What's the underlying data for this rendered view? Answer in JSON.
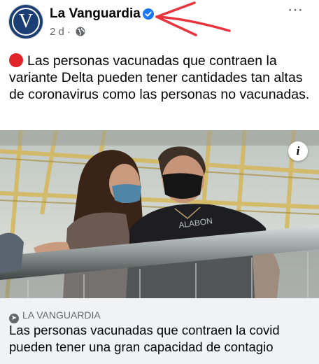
{
  "header": {
    "page_name": "La Vanguardia",
    "avatar_letter": "V",
    "time": "2 d",
    "separator": "·",
    "more_icon": "⋯"
  },
  "post": {
    "text": "Las personas vacunadas que contraen la variante Delta pueden tener cantidades tan altas de coronavirus como las personas no vacunadas."
  },
  "image": {
    "info_icon": "i"
  },
  "link": {
    "source": "LA VANGUARDIA",
    "title": "Las personas vacunadas que contraen la covid pueden tener una gran capacidad de contagio"
  },
  "colors": {
    "avatar": "#1b3f73",
    "verified": "#1877f2",
    "arrow": "#e8343f",
    "red_dot": "#e0242a",
    "link_background": "#f0f2f5"
  }
}
